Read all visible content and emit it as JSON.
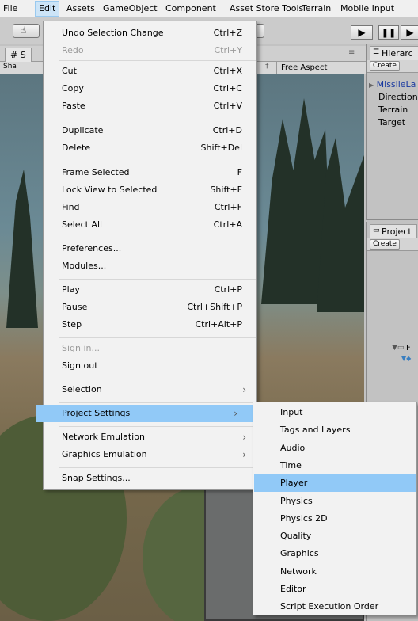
{
  "menubar": {
    "items": [
      "File",
      "Edit",
      "Assets",
      "GameObject",
      "Component",
      "Asset Store Tools",
      "Terrain",
      "Mobile Input"
    ]
  },
  "scene": {
    "tab_label": "# S",
    "shaded_label": "Sha",
    "aspect_label": "Free Aspect"
  },
  "hierarchy": {
    "tab_label": "Hierarc",
    "create_label": "Create",
    "items": [
      "MissileLa",
      "Direction",
      "Terrain",
      "Target"
    ]
  },
  "project": {
    "tab_label": "Project",
    "create_label": "Create",
    "folder_label": "F"
  },
  "edit_menu": {
    "items": [
      {
        "label": "Undo Selection Change",
        "shortcut": "Ctrl+Z",
        "disabled": false
      },
      {
        "label": "Redo",
        "shortcut": "Ctrl+Y",
        "disabled": true
      },
      {
        "label": "Cut",
        "shortcut": "Ctrl+X",
        "disabled": false
      },
      {
        "label": "Copy",
        "shortcut": "Ctrl+C",
        "disabled": false
      },
      {
        "label": "Paste",
        "shortcut": "Ctrl+V",
        "disabled": false
      },
      {
        "label": "Duplicate",
        "shortcut": "Ctrl+D",
        "disabled": false
      },
      {
        "label": "Delete",
        "shortcut": "Shift+Del",
        "disabled": false
      },
      {
        "label": "Frame Selected",
        "shortcut": "F",
        "disabled": false
      },
      {
        "label": "Lock View to Selected",
        "shortcut": "Shift+F",
        "disabled": false
      },
      {
        "label": "Find",
        "shortcut": "Ctrl+F",
        "disabled": false
      },
      {
        "label": "Select All",
        "shortcut": "Ctrl+A",
        "disabled": false
      },
      {
        "label": "Preferences...",
        "shortcut": "",
        "disabled": false
      },
      {
        "label": "Modules...",
        "shortcut": "",
        "disabled": false
      },
      {
        "label": "Play",
        "shortcut": "Ctrl+P",
        "disabled": false
      },
      {
        "label": "Pause",
        "shortcut": "Ctrl+Shift+P",
        "disabled": false
      },
      {
        "label": "Step",
        "shortcut": "Ctrl+Alt+P",
        "disabled": false
      },
      {
        "label": "Sign in...",
        "shortcut": "",
        "disabled": true
      },
      {
        "label": "Sign out",
        "shortcut": "",
        "disabled": false
      },
      {
        "label": "Selection",
        "shortcut": "",
        "disabled": false
      },
      {
        "label": "Project Settings",
        "shortcut": "",
        "disabled": false
      },
      {
        "label": "Network Emulation",
        "shortcut": "",
        "disabled": false
      },
      {
        "label": "Graphics Emulation",
        "shortcut": "",
        "disabled": false
      },
      {
        "label": "Snap Settings...",
        "shortcut": "",
        "disabled": false
      }
    ]
  },
  "project_settings_submenu": {
    "items": [
      "Input",
      "Tags and Layers",
      "Audio",
      "Time",
      "Player",
      "Physics",
      "Physics 2D",
      "Quality",
      "Graphics",
      "Network",
      "Editor",
      "Script Execution Order"
    ]
  }
}
